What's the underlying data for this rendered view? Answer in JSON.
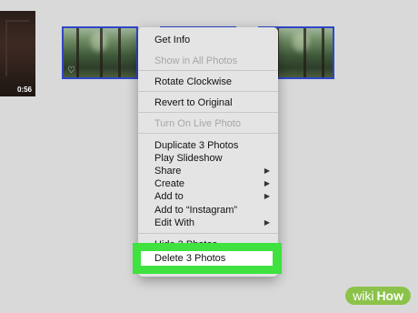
{
  "video": {
    "duration": "0:56"
  },
  "photos": [
    {
      "favorite_icon": "heart-outline-icon",
      "show_favorite": true
    },
    {
      "favorite_icon": "",
      "show_favorite": false
    },
    {
      "favorite_icon": "",
      "show_favorite": false
    }
  ],
  "context_menu": {
    "items": [
      {
        "label": "Get Info",
        "enabled": true
      },
      {
        "label": "Show in All Photos",
        "enabled": false
      },
      {
        "label": "Rotate Clockwise",
        "enabled": true
      },
      {
        "label": "Revert to Original",
        "enabled": true
      },
      {
        "label": "Turn On Live Photo",
        "enabled": false
      },
      {
        "label": "Duplicate 3 Photos",
        "enabled": true
      },
      {
        "label": "Play Slideshow",
        "enabled": true
      },
      {
        "label": "Share",
        "enabled": true,
        "submenu": true
      },
      {
        "label": "Create",
        "enabled": true,
        "submenu": true
      },
      {
        "label": "Add to",
        "enabled": true,
        "submenu": true
      },
      {
        "label": "Add to “Instagram”",
        "enabled": true
      },
      {
        "label": "Edit With",
        "enabled": true,
        "submenu": true
      },
      {
        "label": "Hide 3 Photos",
        "enabled": true
      },
      {
        "label": "Delete 3 Photos",
        "enabled": true,
        "highlighted": true
      }
    ],
    "submenu_arrow": "▶"
  },
  "watermark": {
    "wiki": "wiki",
    "how": "How"
  },
  "colors": {
    "selection_border": "#2f47c8",
    "highlight": "#3fe23f",
    "watermark": "#8bc34a"
  }
}
